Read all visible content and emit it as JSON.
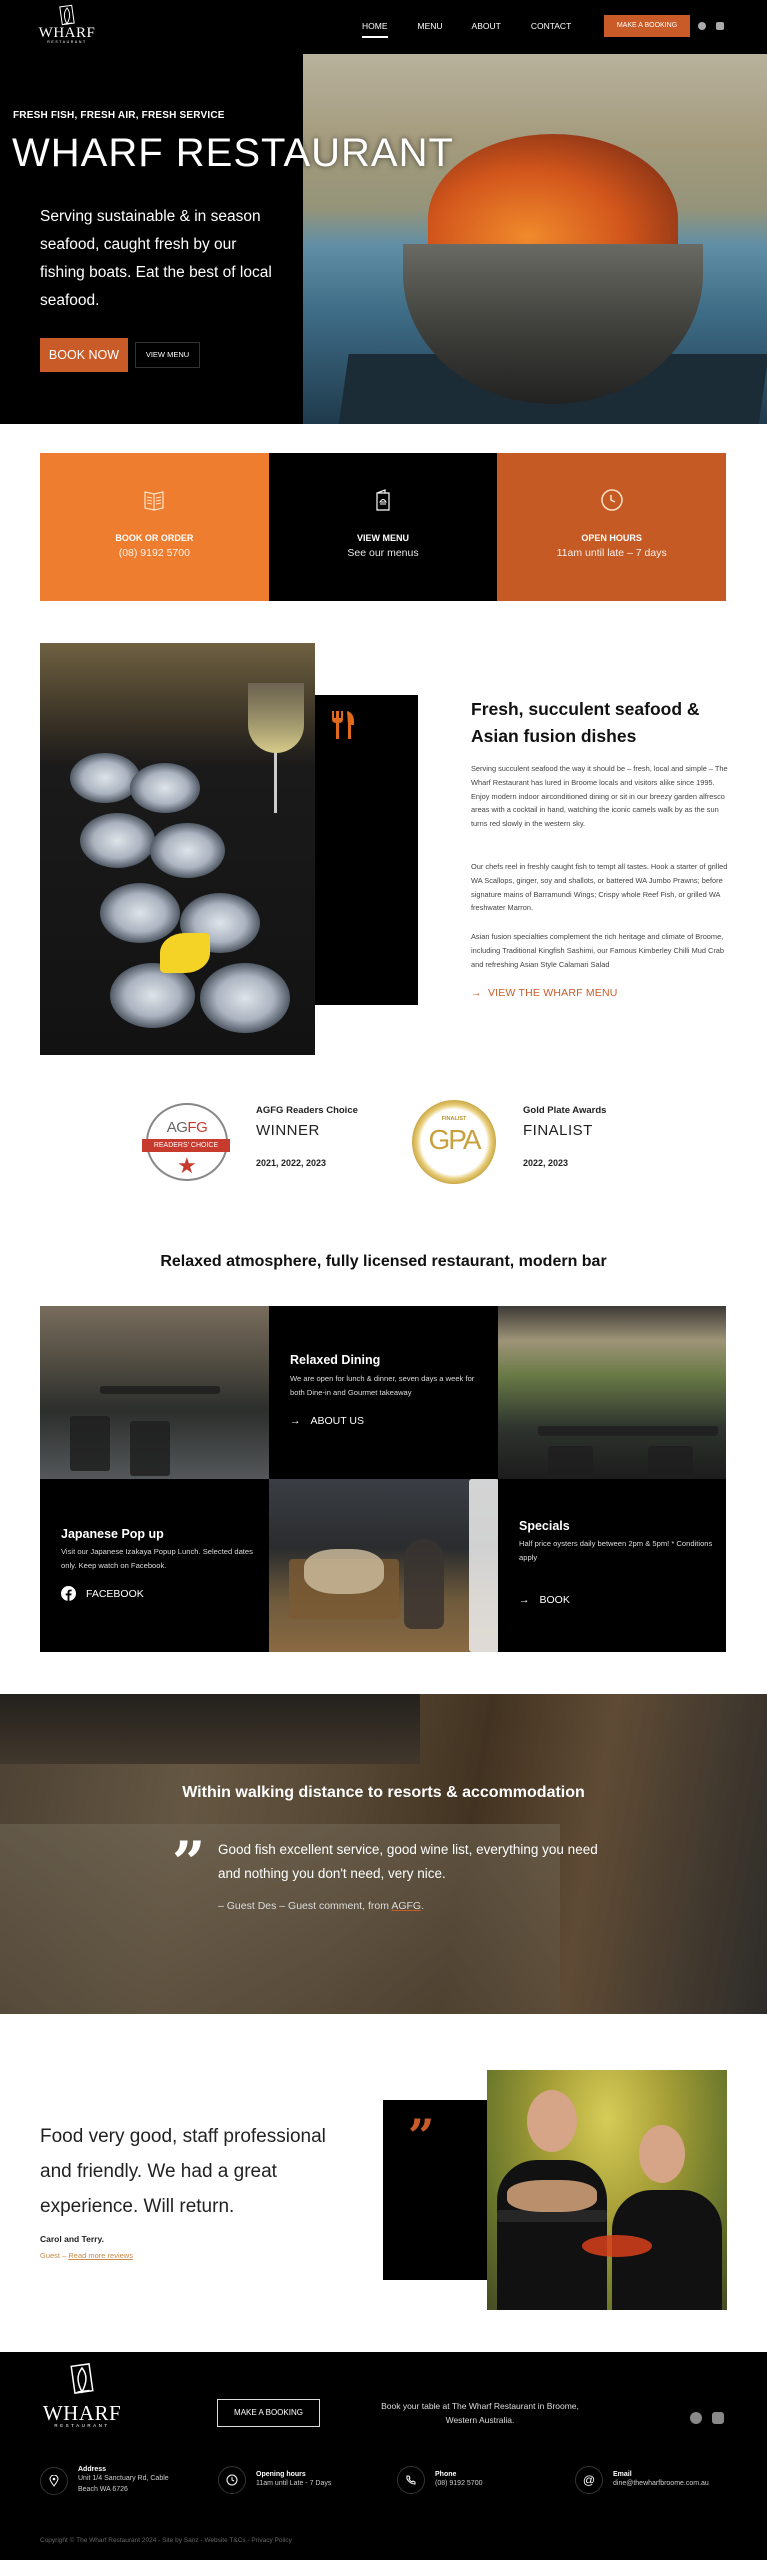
{
  "header": {
    "logo": {
      "wordmark": "WHARF",
      "sub": "RESTAURANT"
    },
    "nav": [
      {
        "label": "HOME",
        "active": true
      },
      {
        "label": "MENU",
        "active": false
      },
      {
        "label": "ABOUT",
        "active": false
      },
      {
        "label": "CONTACT",
        "active": false
      }
    ],
    "booking_button": "MAKE A BOOKING",
    "social": [
      "facebook-icon",
      "instagram-icon"
    ]
  },
  "hero": {
    "kicker": "FRESH FISH, FRESH AIR, FRESH SERVICE",
    "title": "WHARF RESTAURANT",
    "text": "Serving sustainable & in season seafood, caught fresh by our fishing boats. Eat the best of local seafood.",
    "book_button": "BOOK NOW",
    "menu_button": "VIEW MENU"
  },
  "tiles": [
    {
      "icon": "menu-book-icon",
      "title": "BOOK OR ORDER",
      "subtitle": "(08) 9192 5700",
      "color": "#ee7d30"
    },
    {
      "icon": "menu-card-icon",
      "title": "VIEW MENU",
      "subtitle": "See our menus",
      "color": "#000000"
    },
    {
      "icon": "clock-icon",
      "title": "OPEN HOURS",
      "subtitle": "11am until late – 7 days",
      "color": "#c65a24"
    }
  ],
  "about": {
    "title": "Fresh, succulent seafood & Asian fusion dishes",
    "paragraphs": [
      "Serving succulent seafood the way it should be – fresh, local and simple – The Wharf Restaurant has lured in Broome locals and visitors alike since 1995. Enjoy modern indoor airconditioned dining or sit in our breezy garden alfresco areas with a cocktail in hand, watching the iconic camels walk by as the sun turns red slowly in the western sky.",
      "Our chefs reel in freshly caught fish to tempt all tastes. Hook a starter of grilled WA Scallops, ginger, soy and shallots, or battered WA Jumbo Prawns; before signature mains of Barramundi Wings; Crispy whole Reef Fish, or grilled WA freshwater Marron.",
      "Asian fusion specialties complement the rich heritage and climate of Broome, including Traditional Kingfish Sashimi, our Famous Kimberley Chilli Mud Crab and refreshing Asian Style Calamari Salad"
    ],
    "link": "VIEW THE WHARF MENU"
  },
  "awards": [
    {
      "badge": {
        "top": "AGFG",
        "band": "READERS' CHOICE"
      },
      "name": "AGFG Readers Choice",
      "result": "WINNER",
      "years": "2021, 2022, 2023"
    },
    {
      "badge": {
        "top": "FINALIST",
        "mark": "GPA"
      },
      "name": "Gold Plate Awards",
      "result": "FINALIST",
      "years": "2022, 2023"
    }
  ],
  "atmosphere": {
    "title": "Relaxed atmosphere, fully licensed restaurant, modern bar",
    "cards": [
      {
        "title": "Relaxed Dining",
        "text": "We are open for lunch & dinner, seven days a week for both Dine-in and Gourmet takeaway",
        "link": "ABOUT US"
      },
      {
        "title": "Japanese Pop up",
        "text": "Visit our Japanese Izakaya Popup Lunch. Selected dates only. Keep watch on Facebook.",
        "link": "FACEBOOK"
      },
      {
        "title": "Specials",
        "text": "Half price oysters daily between 2pm & 5pm! * Conditions apply",
        "link": "BOOK"
      }
    ]
  },
  "banner": {
    "title": "Within walking distance to resorts & accommodation",
    "quote": "Good fish excellent service, good wine list, everything you need and nothing you don't need, very nice.",
    "cite_prefix": "– Guest Des – Guest comment, from ",
    "cite_link": "AGFG",
    "cite_suffix": "."
  },
  "testimonial": {
    "quote": "Food very good, staff professional and friendly. We had a great experience. Will return.",
    "name": "Carol and Terry.",
    "role": "Guest – ",
    "link": "Read more reviews"
  },
  "footer": {
    "booking_button": "MAKE A BOOKING",
    "text": "Book your table at The Wharf Restaurant in Broome, Western Australia.",
    "contacts": [
      {
        "icon": "location-pin-icon",
        "label": "Address",
        "value": "Unit 1/4 Sanctuary Rd, Cable Beach WA 6726"
      },
      {
        "icon": "clock-icon",
        "label": "Opening hours",
        "value": "11am until Late - 7 Days"
      },
      {
        "icon": "phone-icon",
        "label": "Phone",
        "value": "(08) 9192 5700"
      },
      {
        "icon": "at-sign-icon",
        "label": "Email",
        "value": "dine@thewharfbroome.com.au"
      }
    ],
    "copyright": "Copyright © The Wharf Restaurant 2024 - Site by Sanz - Website T&Cs - Privacy Policy"
  },
  "colors": {
    "accent": "#c95b28",
    "orange": "#ee7d30",
    "dark": "#000000"
  }
}
